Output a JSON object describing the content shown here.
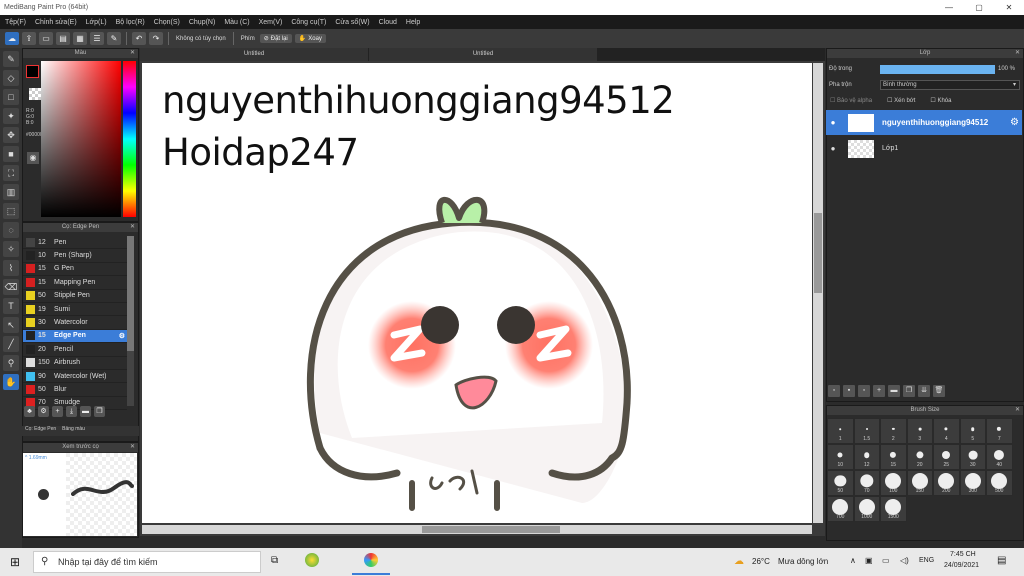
{
  "app": {
    "title": "MediBang Paint Pro (64bit)"
  },
  "menu": [
    "Tệp(F)",
    "Chỉnh sửa(E)",
    "Lớp(L)",
    "Bộ lọc(R)",
    "Chọn(S)",
    "Chụp(N)",
    "Màu (C)",
    "Xem(V)",
    "Công cụ(T)",
    "Cửa sổ(W)",
    "Cloud",
    "Help"
  ],
  "toolbar": {
    "no_select_label": "Không có tùy chọn",
    "key_label": "Phím",
    "invert_label": "Đặt lại",
    "rotate_label": "Xoay"
  },
  "color_panel": {
    "title": "Màu",
    "r": "R:0",
    "g": "G:0",
    "b": "B:0",
    "hex": "#000000"
  },
  "brush_panel": {
    "title": "Cọ: Edge Pen",
    "items": [
      {
        "size": "12",
        "name": "Pen",
        "color": "#444444"
      },
      {
        "size": "10",
        "name": "Pen (Sharp)",
        "color": "#222222"
      },
      {
        "size": "15",
        "name": "G Pen",
        "color": "#d62020"
      },
      {
        "size": "15",
        "name": "Mapping Pen",
        "color": "#d62020"
      },
      {
        "size": "50",
        "name": "Stipple Pen",
        "color": "#e8d020"
      },
      {
        "size": "19",
        "name": "Sumi",
        "color": "#e8d020"
      },
      {
        "size": "30",
        "name": "Watercolor",
        "color": "#e8d020"
      },
      {
        "size": "15",
        "name": "Edge Pen",
        "color": "#222222"
      },
      {
        "size": "20",
        "name": "Pencil",
        "color": "#222222"
      },
      {
        "size": "150",
        "name": "Airbrush",
        "color": "#dddddd"
      },
      {
        "size": "90",
        "name": "Watercolor (Wet)",
        "color": "#40c0f0"
      },
      {
        "size": "50",
        "name": "Blur",
        "color": "#dd2020"
      },
      {
        "size": "70",
        "name": "Smudge",
        "color": "#dd2020"
      }
    ],
    "tab1": "Cọ: Edge Pen",
    "tab2": "Bảng màu"
  },
  "preview": {
    "title": "Xem trước cọ",
    "size": "1.69mm"
  },
  "tabs": [
    "Untitled",
    "Untitled"
  ],
  "canvas": {
    "line1": "nguyenthihuonggiang94512",
    "line2": "Hoidap247"
  },
  "layer_panel": {
    "title": "Lớp",
    "opacity_label": "Độ trong",
    "opacity_value": "100 %",
    "blend_label": "Pha trộn",
    "blend_value": "Bình thường",
    "protect_alpha": "Bảo vệ alpha",
    "clipping": "Xén bớt",
    "lock": "Khóa",
    "layers": [
      {
        "name": "nguyenthihuonggiang94512",
        "selected": true
      },
      {
        "name": "Lớp1",
        "selected": false
      }
    ]
  },
  "brush_size": {
    "title": "Brush Size",
    "sizes": [
      "1",
      "1.5",
      "2",
      "3",
      "4",
      "5",
      "7",
      "10",
      "12",
      "15",
      "20",
      "25",
      "30",
      "40",
      "50",
      "70",
      "100",
      "150",
      "200",
      "300",
      "500",
      "700",
      "1000",
      "1500"
    ]
  },
  "taskbar": {
    "search_placeholder": "Nhập tại đây để tìm kiếm",
    "weather_temp": "26°C",
    "weather_desc": "Mưa dông lớn",
    "lang": "ENG",
    "time": "7:45 CH",
    "date": "24/09/2021"
  }
}
